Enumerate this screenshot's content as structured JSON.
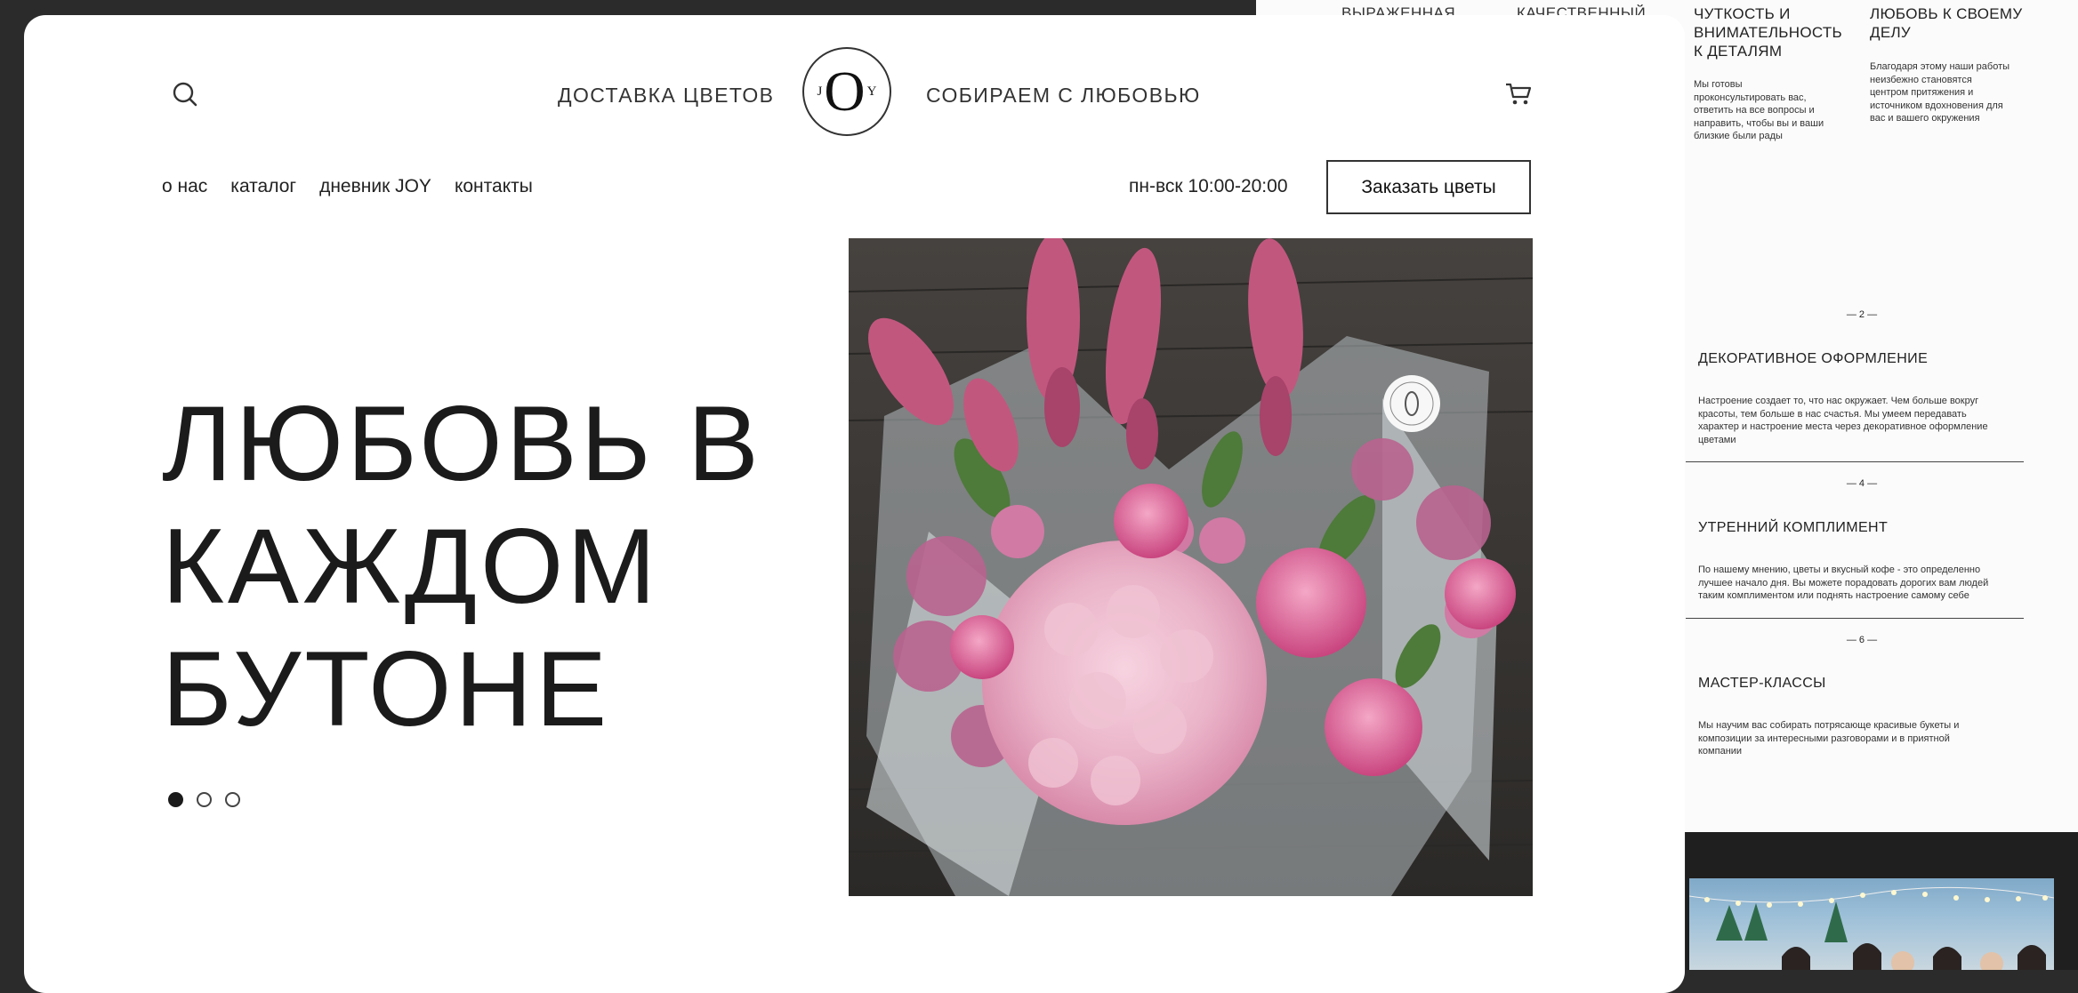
{
  "header": {
    "tagline_left": "ДОСТАВКА ЦВЕТОВ",
    "tagline_right": "СОБИРАЕМ С ЛЮБОВЬЮ",
    "logo": {
      "left": "J",
      "center": "O",
      "right": "Y"
    }
  },
  "nav": {
    "items": [
      "о нас",
      "каталог",
      "дневник JOY",
      "контакты"
    ]
  },
  "hours": "пн-вск 10:00-20:00",
  "cta_label": "Заказать цветы",
  "hero": {
    "line1": "ЛЮБОВЬ В",
    "line2": "КАЖДОМ",
    "line3": "БУТОНЕ"
  },
  "slider": {
    "count": 3,
    "active": 1
  },
  "background_page": {
    "top_headers": [
      "ВЫРАЖЕННАЯ",
      "КАЧЕСТВЕННЫЙ"
    ],
    "columns": [
      {
        "title_lines": [
          "ЧУТКОСТЬ И",
          "ВНИМАТЕЛЬНОСТЬ",
          "К ДЕТАЛЯМ"
        ],
        "text_lines": [
          "Мы готовы",
          "проконсультировать вас,",
          "ответить на все вопросы и",
          "направить, чтобы вы и ваши",
          "близкие были рады"
        ]
      },
      {
        "title_lines": [
          "ЛЮБОВЬ К СВОЕМУ",
          "ДЕЛУ"
        ],
        "text_lines": [
          "Благодаря этому наши работы",
          "неизбежно становятся",
          "центром притяжения и",
          "источником вдохновения для",
          "вас и вашего окружения"
        ]
      }
    ],
    "sections": [
      {
        "number": "— 2 —",
        "title": "ДЕКОРАТИВНОЕ ОФОРМЛЕНИЕ",
        "text_lines": [
          "Настроение создает то, что нас окружает. Чем больше вокруг",
          "красоты, тем больше в нас счастья. Мы умеем передавать",
          "характер и настроение места через декоративное оформление",
          "цветами"
        ]
      },
      {
        "number": "— 4 —",
        "title": "УТРЕННИЙ КОМПЛИМЕНТ",
        "text_lines": [
          "По нашему мнению, цветы и вкусный кофе - это определенно",
          "лучшее начало дня. Вы можете порадовать дорогих вам людей",
          "таким комплиментом или поднять настроение самому себе"
        ]
      },
      {
        "number": "— 6 —",
        "title": "МАСТЕР-КЛАССЫ",
        "text_lines": [
          "Мы научим вас собирать потрясающе красивые букеты и",
          "композиции за интересными разговорами и в приятной",
          "компании"
        ]
      }
    ]
  }
}
